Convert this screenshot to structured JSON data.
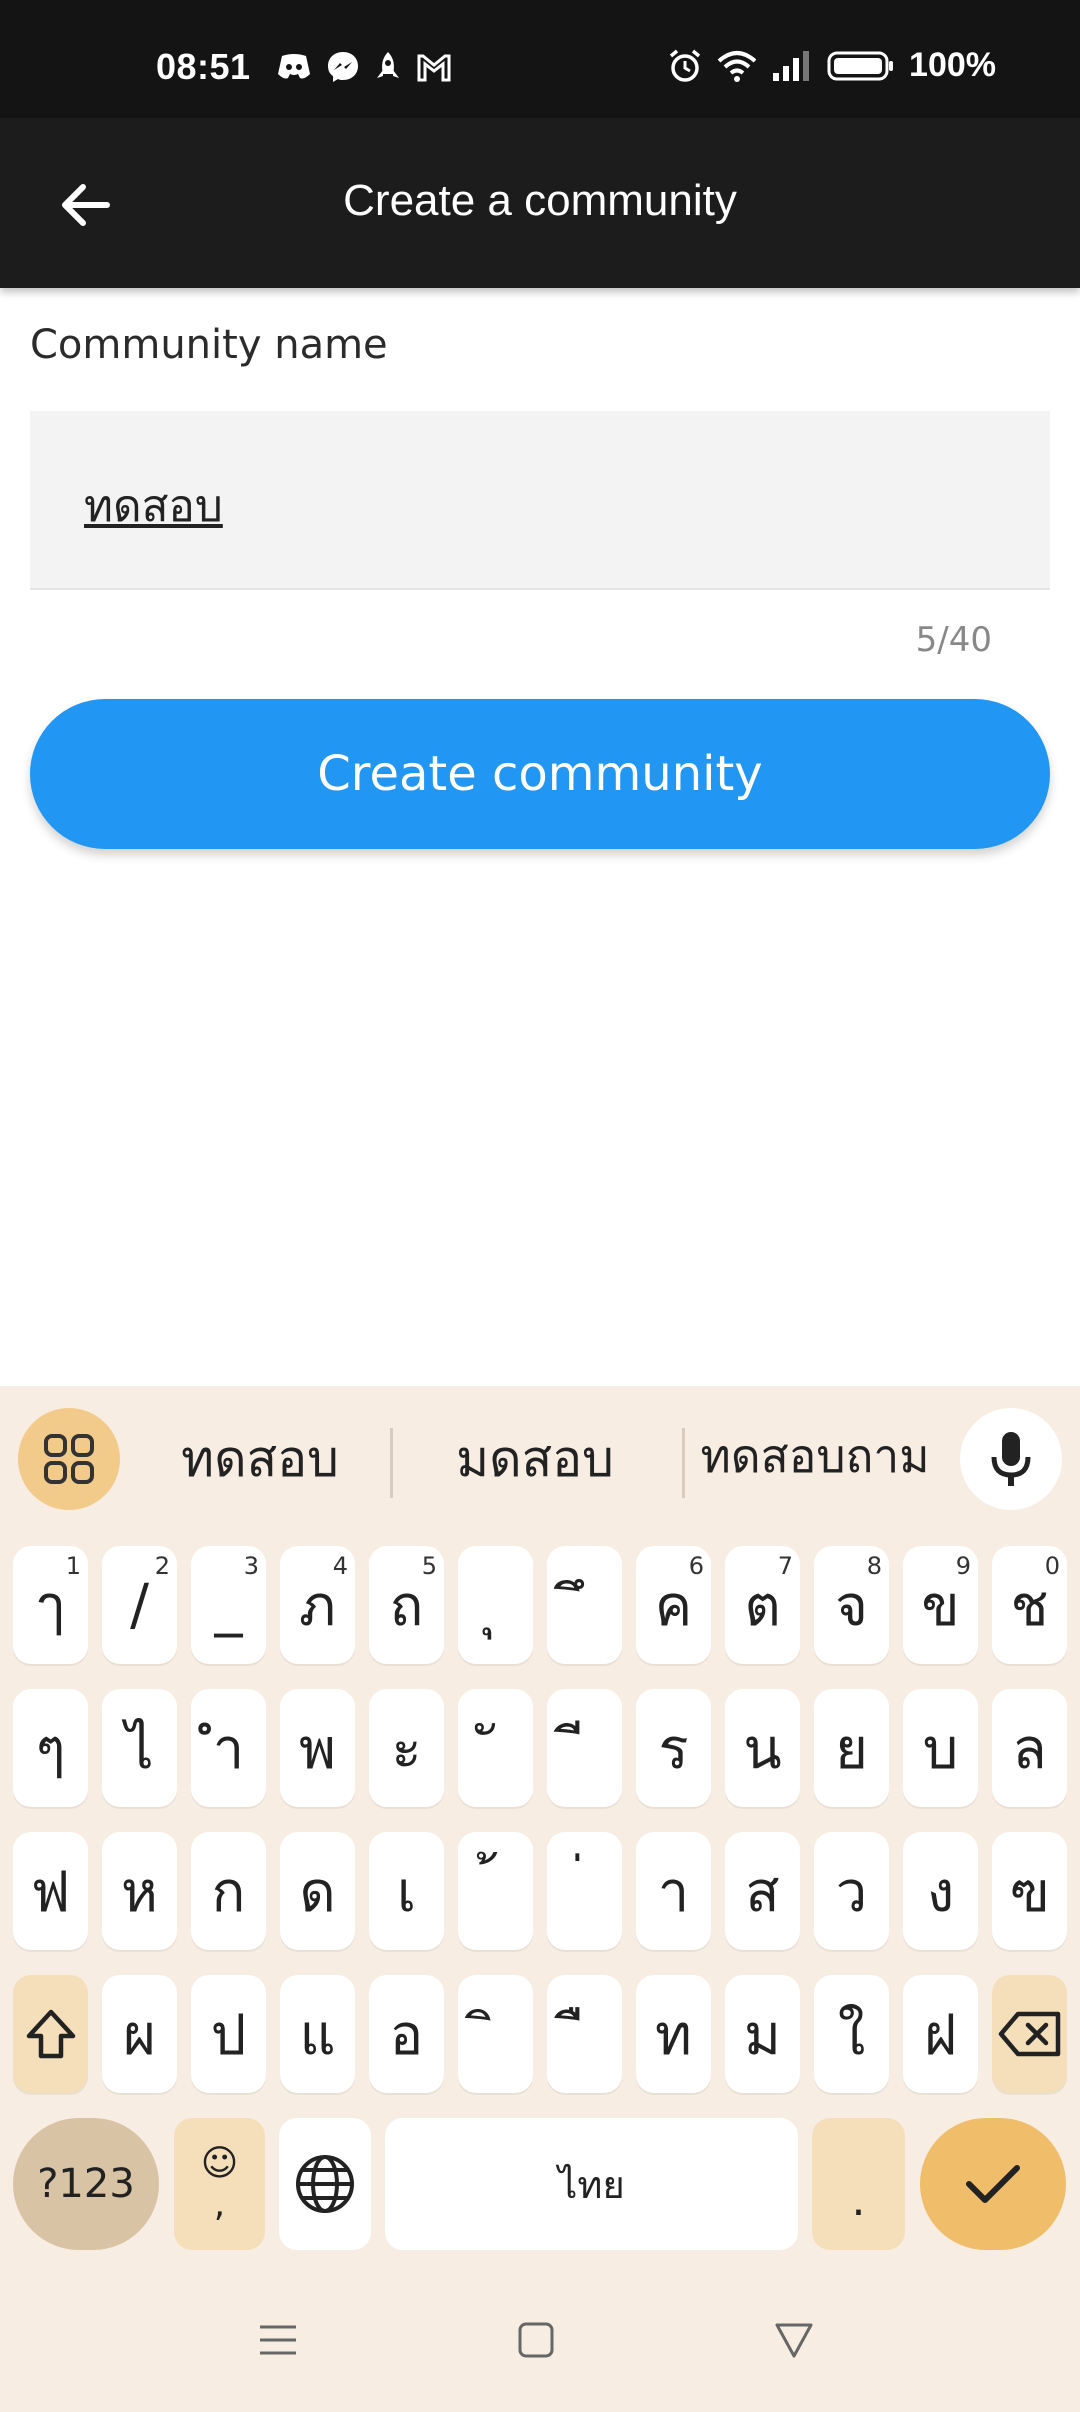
{
  "status_bar": {
    "time": "08:51",
    "notification_icons": [
      "discord-icon",
      "messenger-icon",
      "rocket-icon",
      "gmail-icon"
    ],
    "right_icons": [
      "alarm-icon",
      "wifi-icon",
      "signal-icon",
      "battery-icon"
    ],
    "battery_percent": "100%"
  },
  "app_bar": {
    "back_icon": "arrow-back-icon",
    "title": "Create a community"
  },
  "form": {
    "name_label": "Community name",
    "name_value": "ทดสอบ",
    "char_count": "5/40",
    "submit_label": "Create community"
  },
  "colors": {
    "primary_button": "#2196f3",
    "app_bar": "#1c1c1c",
    "keyboard_bg": "#f7ede3",
    "keyboard_accent": "#f0bd6a"
  },
  "keyboard": {
    "suggestions": [
      "ทดสอบ",
      "มดสอบ",
      "ทดสอบถาม"
    ],
    "row1": [
      {
        "k": "ๅ",
        "h": "1"
      },
      {
        "k": "/",
        "h": "2"
      },
      {
        "k": "_",
        "h": "3"
      },
      {
        "k": "ภ",
        "h": "4"
      },
      {
        "k": "ถ",
        "h": "5"
      },
      {
        "k": "ุ",
        "h": ""
      },
      {
        "k": "ึ",
        "h": ""
      },
      {
        "k": "ค",
        "h": "6"
      },
      {
        "k": "ต",
        "h": "7"
      },
      {
        "k": "จ",
        "h": "8"
      },
      {
        "k": "ข",
        "h": "9"
      },
      {
        "k": "ช",
        "h": "0"
      }
    ],
    "row2": [
      "ๆ",
      "ไ",
      "ำ",
      "พ",
      "ะ",
      "ั",
      "ี",
      "ร",
      "น",
      "ย",
      "บ",
      "ล"
    ],
    "row3": [
      "ฟ",
      "ห",
      "ก",
      "ด",
      "เ",
      "้",
      "่",
      "า",
      "ส",
      "ว",
      "ง",
      "ฃ"
    ],
    "row4": [
      "ผ",
      "ป",
      "แ",
      "อ",
      "ิ",
      "ื",
      "ท",
      "ม",
      "ใ",
      "ฝ"
    ],
    "symbols_label": "?123",
    "emoji_key": {
      "top": "☺",
      "bottom": ","
    },
    "space_label": "ไทย",
    "period_label": "."
  },
  "nav_bar": {
    "icons": [
      "menu-icon",
      "home-icon",
      "back-triangle-icon"
    ]
  }
}
